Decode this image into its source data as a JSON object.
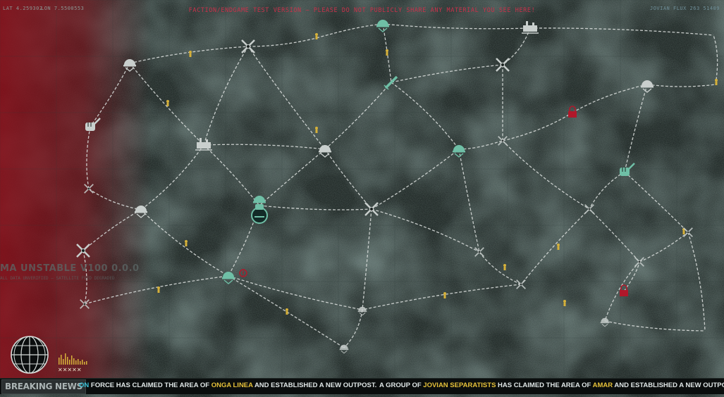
{
  "hud": {
    "lat": "LAT 4.259302",
    "lon": "LON 7.5500553",
    "warning": "FACTION/ENDGAME TEST VERSION – PLEASE DO NOT PUBLICLY SHARE ANY MATERIAL YOU SEE HERE!",
    "flux": "JOVIAN FLUX 263 51409",
    "version": "MA UNSTABLE V100 0.0.0",
    "version_sub": "ALL DATA UNVERIFIED – SATELLITE FEED DEGRADED"
  },
  "ticker": {
    "breaking_label": "BREAKING NEWS",
    "news1": {
      "a": "ON",
      "b": " FORCE HAS CLAIMED THE AREA OF ",
      "c": "ONGA LINEA",
      "d": " AND ESTABLISHED A NEW OUTPOST."
    },
    "news2": {
      "a": "A GROUP OF ",
      "b": "JOVIAN SEPARATISTS",
      "c": " HAS CLAIMED THE AREA OF ",
      "d": "AMAR",
      "e": " AND ESTABLISHED A NEW OUTPOST."
    }
  },
  "colors": {
    "enemy_red": "#b0182a",
    "ally_teal": "#6fbfa6",
    "neutral": "#c9cfcd",
    "warning": "#c9314a",
    "cyan": "#39c0d6",
    "yellow": "#e5c13a"
  },
  "map": {
    "nodes": [
      {
        "id": "n1",
        "kind": "helmet",
        "faction": "neutral",
        "icon": "helmet-fist-icon"
      },
      {
        "id": "n2",
        "kind": "crossed-swords",
        "faction": "neutral",
        "icon": "crossed-swords-icon"
      },
      {
        "id": "n3",
        "kind": "helmet",
        "faction": "ally",
        "icon": "helmet-icon"
      },
      {
        "id": "n4",
        "kind": "building",
        "faction": "neutral",
        "icon": "outpost-icon"
      },
      {
        "id": "n5",
        "kind": "crossed-swords",
        "faction": "neutral",
        "icon": "crossed-swords-icon"
      },
      {
        "id": "n6",
        "kind": "fist",
        "faction": "neutral",
        "icon": "fist-icon"
      },
      {
        "id": "n7",
        "kind": "building",
        "faction": "neutral",
        "icon": "outpost-icon"
      },
      {
        "id": "n8",
        "kind": "helmet",
        "faction": "neutral",
        "icon": "helmet-icon"
      },
      {
        "id": "n9",
        "kind": "knife",
        "faction": "ally",
        "icon": "knife-icon"
      },
      {
        "id": "n10",
        "kind": "helmet",
        "faction": "ally",
        "icon": "helmet-icon"
      },
      {
        "id": "n11",
        "kind": "player-hq",
        "faction": "ally",
        "icon": "player-hq-icon"
      },
      {
        "id": "n12",
        "kind": "helmet",
        "faction": "neutral",
        "icon": "helmet-icon"
      },
      {
        "id": "n13",
        "kind": "lock",
        "faction": "enemy",
        "icon": "lock-icon"
      },
      {
        "id": "n14",
        "kind": "helmet",
        "faction": "neutral",
        "icon": "helmet-icon"
      },
      {
        "id": "n15",
        "kind": "crossed-swords",
        "faction": "neutral",
        "icon": "crossed-swords-icon"
      },
      {
        "id": "n16",
        "kind": "helmet",
        "faction": "ally",
        "icon": "helmet-icon"
      },
      {
        "id": "n17",
        "kind": "fist",
        "faction": "ally",
        "icon": "fist-icon"
      },
      {
        "id": "n18",
        "kind": "crossed-swords",
        "faction": "neutral",
        "icon": "crossed-swords-icon"
      },
      {
        "id": "n19",
        "kind": "warning",
        "faction": "enemy",
        "icon": "warning-icon"
      },
      {
        "id": "n20",
        "kind": "lock",
        "faction": "enemy",
        "icon": "lock-icon"
      }
    ]
  }
}
